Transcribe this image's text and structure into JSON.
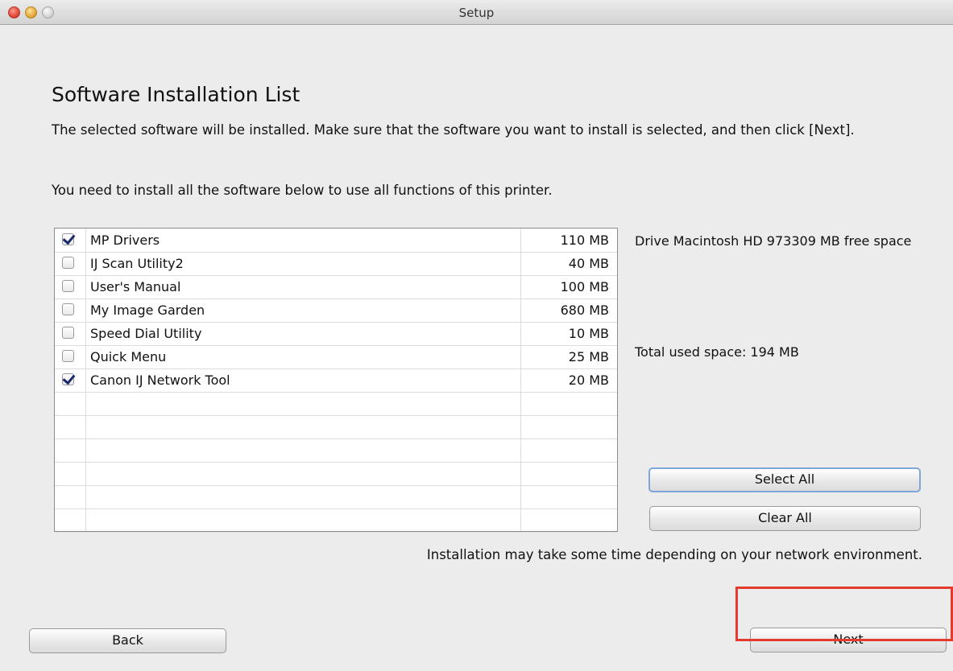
{
  "window": {
    "title": "Setup"
  },
  "heading": "Software Installation List",
  "description": "The selected software will be installed. Make sure that the software you want to install is selected, and then click [Next].",
  "note": "You need to install all the software below to use all functions of this printer.",
  "software": [
    {
      "name": "MP Drivers",
      "size": "110 MB",
      "checked": true
    },
    {
      "name": "IJ Scan Utility2",
      "size": "40 MB",
      "checked": false
    },
    {
      "name": "User's Manual",
      "size": "100 MB",
      "checked": false
    },
    {
      "name": "My Image Garden",
      "size": "680 MB",
      "checked": false
    },
    {
      "name": "Speed Dial Utility",
      "size": "10 MB",
      "checked": false
    },
    {
      "name": "Quick Menu",
      "size": "25 MB",
      "checked": false
    },
    {
      "name": "Canon IJ Network Tool",
      "size": "20 MB",
      "checked": true
    }
  ],
  "drive_info": "Drive Macintosh HD 973309 MB free space",
  "total_used": "Total used space: 194 MB",
  "buttons": {
    "select_all": "Select All",
    "clear_all": "Clear All",
    "back": "Back",
    "next": "Next"
  },
  "install_note": "Installation may take some time depending on your network environment.",
  "colors": {
    "highlight": "#e53a2e",
    "focus_ring": "#7fa6d8",
    "checkmark": "#1a2a6a"
  }
}
